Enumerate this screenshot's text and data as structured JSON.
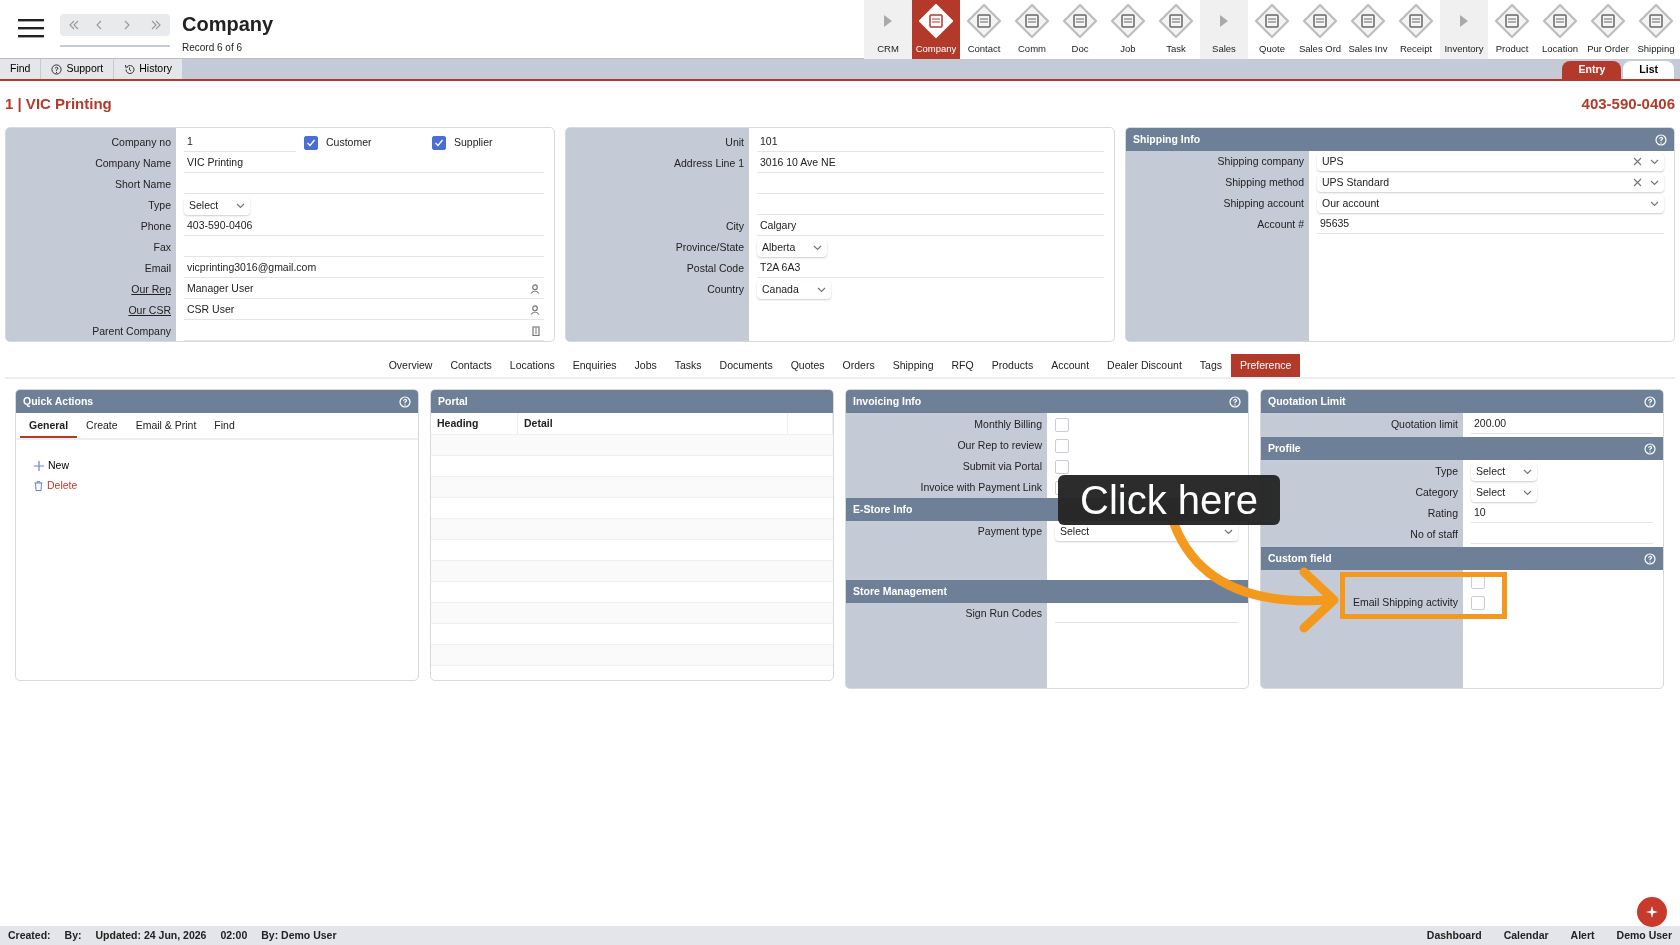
{
  "header": {
    "title": "Company",
    "subtitle": "Record 6 of 6"
  },
  "modules": [
    {
      "label": "CRM",
      "kind": "group",
      "selected": false
    },
    {
      "label": "Company",
      "kind": "module",
      "selected": true
    },
    {
      "label": "Contact",
      "kind": "module",
      "selected": false
    },
    {
      "label": "Comm",
      "kind": "module",
      "selected": false
    },
    {
      "label": "Doc",
      "kind": "module",
      "selected": false
    },
    {
      "label": "Job",
      "kind": "module",
      "selected": false
    },
    {
      "label": "Task",
      "kind": "module",
      "selected": false
    },
    {
      "label": "Sales",
      "kind": "group",
      "selected": false
    },
    {
      "label": "Quote",
      "kind": "module",
      "selected": false
    },
    {
      "label": "Sales Ord",
      "kind": "module",
      "selected": false
    },
    {
      "label": "Sales Inv",
      "kind": "module",
      "selected": false
    },
    {
      "label": "Receipt",
      "kind": "module",
      "selected": false
    },
    {
      "label": "Inventory",
      "kind": "group",
      "selected": false
    },
    {
      "label": "Product",
      "kind": "module",
      "selected": false
    },
    {
      "label": "Location",
      "kind": "module",
      "selected": false
    },
    {
      "label": "Pur Order",
      "kind": "module",
      "selected": false
    },
    {
      "label": "Shipping",
      "kind": "module",
      "selected": false
    }
  ],
  "toolbar": [
    {
      "label": "Find",
      "kind": "plain"
    },
    {
      "label": "Support",
      "kind": "help"
    },
    {
      "label": "History",
      "kind": "history"
    }
  ],
  "view_tabs": [
    {
      "label": "Entry",
      "selected": true
    },
    {
      "label": "List",
      "selected": false
    }
  ],
  "record": {
    "title": "1 | VIC Printing",
    "phone": "403-590-0406"
  },
  "company_panel": [
    {
      "label": "Company no",
      "kind": "text",
      "value": "1",
      "flags": [
        {
          "label": "Customer",
          "checked": true
        },
        {
          "label": "Supplier",
          "checked": true
        }
      ]
    },
    {
      "label": "Company Name",
      "kind": "text",
      "value": "VIC Printing"
    },
    {
      "label": "Short Name",
      "kind": "text"
    },
    {
      "label": "Type",
      "kind": "select",
      "value": "Select"
    },
    {
      "label": "Phone",
      "kind": "text",
      "value": "403-590-0406"
    },
    {
      "label": "Fax",
      "kind": "text"
    },
    {
      "label": "Email",
      "kind": "text",
      "value": "vicprinting3016@gmail.com"
    },
    {
      "label": "Our Rep",
      "kind": "person",
      "value": "Manager User",
      "link": true
    },
    {
      "label": "Our CSR",
      "kind": "person",
      "value": "CSR User",
      "link": true
    },
    {
      "label": "Parent Company",
      "kind": "building"
    }
  ],
  "address_panel": [
    {
      "label": "Unit",
      "kind": "text",
      "value": "101"
    },
    {
      "label": "Address Line 1",
      "kind": "text",
      "value": "3016 10 Ave NE"
    },
    {
      "kind": "text"
    },
    {
      "kind": "text"
    },
    {
      "label": "City",
      "kind": "text",
      "value": "Calgary"
    },
    {
      "label": "Province/State",
      "kind": "select",
      "value": "Alberta"
    },
    {
      "label": "Postal Code",
      "kind": "text",
      "value": "T2A 6A3"
    },
    {
      "label": "Country",
      "kind": "select",
      "value": "Canada"
    }
  ],
  "shipping_panel": {
    "title": "Shipping Info",
    "rows": [
      {
        "label": "Shipping company",
        "kind": "clearable",
        "value": "UPS"
      },
      {
        "label": "Shipping method",
        "kind": "clearable",
        "value": "UPS Standard"
      },
      {
        "label": "Shipping account",
        "kind": "wideselect",
        "value": "Our account"
      },
      {
        "label": "Account #",
        "kind": "text",
        "value": "95635"
      }
    ]
  },
  "detail_tabs": [
    {
      "label": "Overview",
      "selected": false
    },
    {
      "label": "Contacts",
      "selected": false
    },
    {
      "label": "Locations",
      "selected": false
    },
    {
      "label": "Enquiries",
      "selected": false
    },
    {
      "label": "Jobs",
      "selected": false
    },
    {
      "label": "Tasks",
      "selected": false
    },
    {
      "label": "Documents",
      "selected": false
    },
    {
      "label": "Quotes",
      "selected": false
    },
    {
      "label": "Orders",
      "selected": false
    },
    {
      "label": "Shipping",
      "selected": false
    },
    {
      "label": "RFQ",
      "selected": false
    },
    {
      "label": "Products",
      "selected": false
    },
    {
      "label": "Account",
      "selected": false
    },
    {
      "label": "Dealer Discount",
      "selected": false
    },
    {
      "label": "Tags",
      "selected": false
    },
    {
      "label": "Preference",
      "selected": true
    }
  ],
  "quick_actions": {
    "title": "Quick Actions",
    "tabs": [
      {
        "label": "General",
        "selected": true
      },
      {
        "label": "Create",
        "selected": false
      },
      {
        "label": "Email & Print",
        "selected": false
      },
      {
        "label": "Find",
        "selected": false
      }
    ],
    "actions": [
      {
        "label": "New",
        "kind": "add"
      },
      {
        "label": "Delete",
        "kind": "delete"
      }
    ]
  },
  "portal": {
    "title": "Portal",
    "columns": [
      "Heading",
      "Detail"
    ]
  },
  "invoicing": {
    "title": "Invoicing Info",
    "rows": [
      {
        "label": "Monthly Billing",
        "kind": "check",
        "checked": false
      },
      {
        "label": "Our Rep to review",
        "kind": "check",
        "checked": false
      },
      {
        "label": "Submit via Portal",
        "kind": "check",
        "checked": false
      },
      {
        "label": "Invoice with Payment Link",
        "kind": "check",
        "checked": false
      }
    ]
  },
  "estore": {
    "title": "E-Store Info",
    "rows": [
      {
        "label": "Payment type",
        "kind": "wideselect",
        "value": "Select"
      }
    ]
  },
  "store_management": {
    "title": "Store Management",
    "rows": [
      {
        "label": "Sign Run Codes",
        "kind": "text"
      }
    ]
  },
  "quotation": {
    "title": "Quotation Limit",
    "rows": [
      {
        "label": "Quotation limit",
        "kind": "text",
        "value": "200.00"
      }
    ]
  },
  "profile": {
    "title": "Profile",
    "rows": [
      {
        "label": "Type",
        "kind": "select",
        "value": "Select"
      },
      {
        "label": "Category",
        "kind": "select",
        "value": "Select"
      },
      {
        "label": "Rating",
        "kind": "text",
        "value": "10"
      },
      {
        "label": "No of staff",
        "kind": "text"
      }
    ]
  },
  "custom_field": {
    "title": "Custom field",
    "rows": [
      {
        "kind": "check",
        "checked": false
      },
      {
        "label": "Email Shipping activity",
        "kind": "check",
        "checked": false
      }
    ]
  },
  "callout": {
    "text": "Click here"
  },
  "footer": {
    "left": [
      {
        "label": "Created:"
      },
      {
        "label": "By:"
      },
      {
        "label": "Updated: 24 Jun, 2026"
      },
      {
        "label": "02:00"
      },
      {
        "label": "By: Demo User"
      }
    ],
    "right": [
      "Dashboard",
      "Calendar",
      "Alert",
      "Demo User"
    ]
  }
}
